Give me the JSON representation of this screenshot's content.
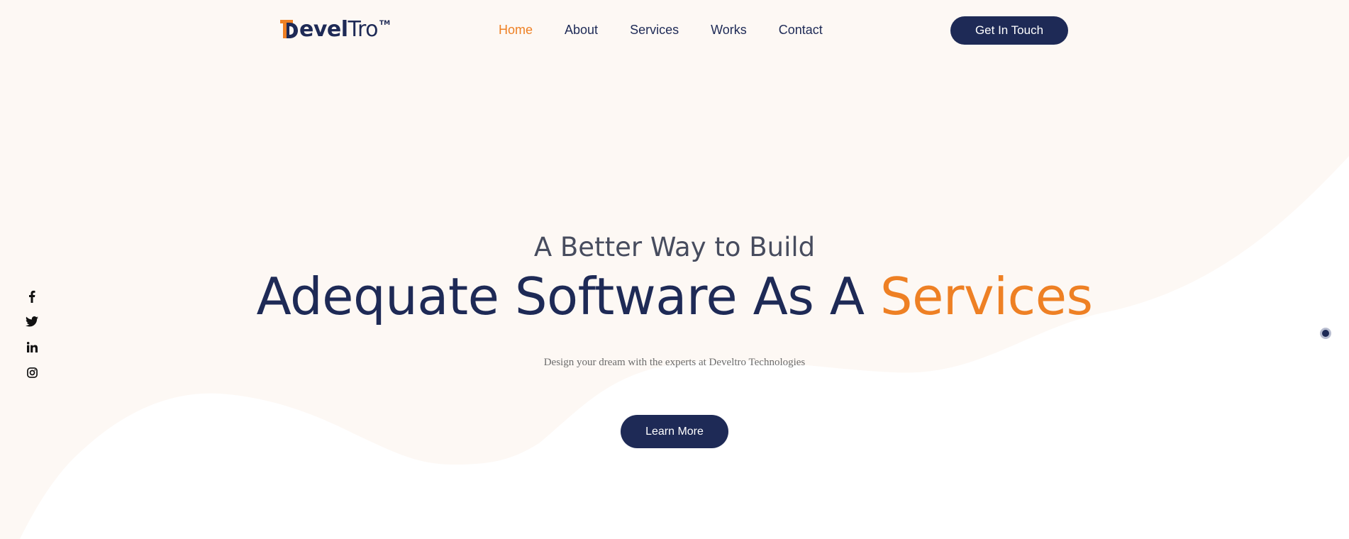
{
  "brand": {
    "logo_bold": "evel",
    "logo_light": "Tro",
    "logo_tm": "TM",
    "primary_color": "#1e2a56",
    "accent_color": "#ee8024",
    "background_color": "#fdf8f4"
  },
  "nav": {
    "items": [
      {
        "label": "Home",
        "active": true
      },
      {
        "label": "About",
        "active": false
      },
      {
        "label": "Services",
        "active": false
      },
      {
        "label": "Works",
        "active": false
      },
      {
        "label": "Contact",
        "active": false
      }
    ],
    "cta_label": "Get In Touch"
  },
  "social": {
    "icons": [
      "facebook-icon",
      "twitter-icon",
      "linkedin-icon",
      "instagram-icon"
    ]
  },
  "hero": {
    "subheading": "A Better Way to Build",
    "headline_main": "Adequate Software As A ",
    "headline_accent": "Services",
    "tagline": "Design your dream with the experts at Develtro Technologies",
    "cta_label": "Learn More"
  }
}
